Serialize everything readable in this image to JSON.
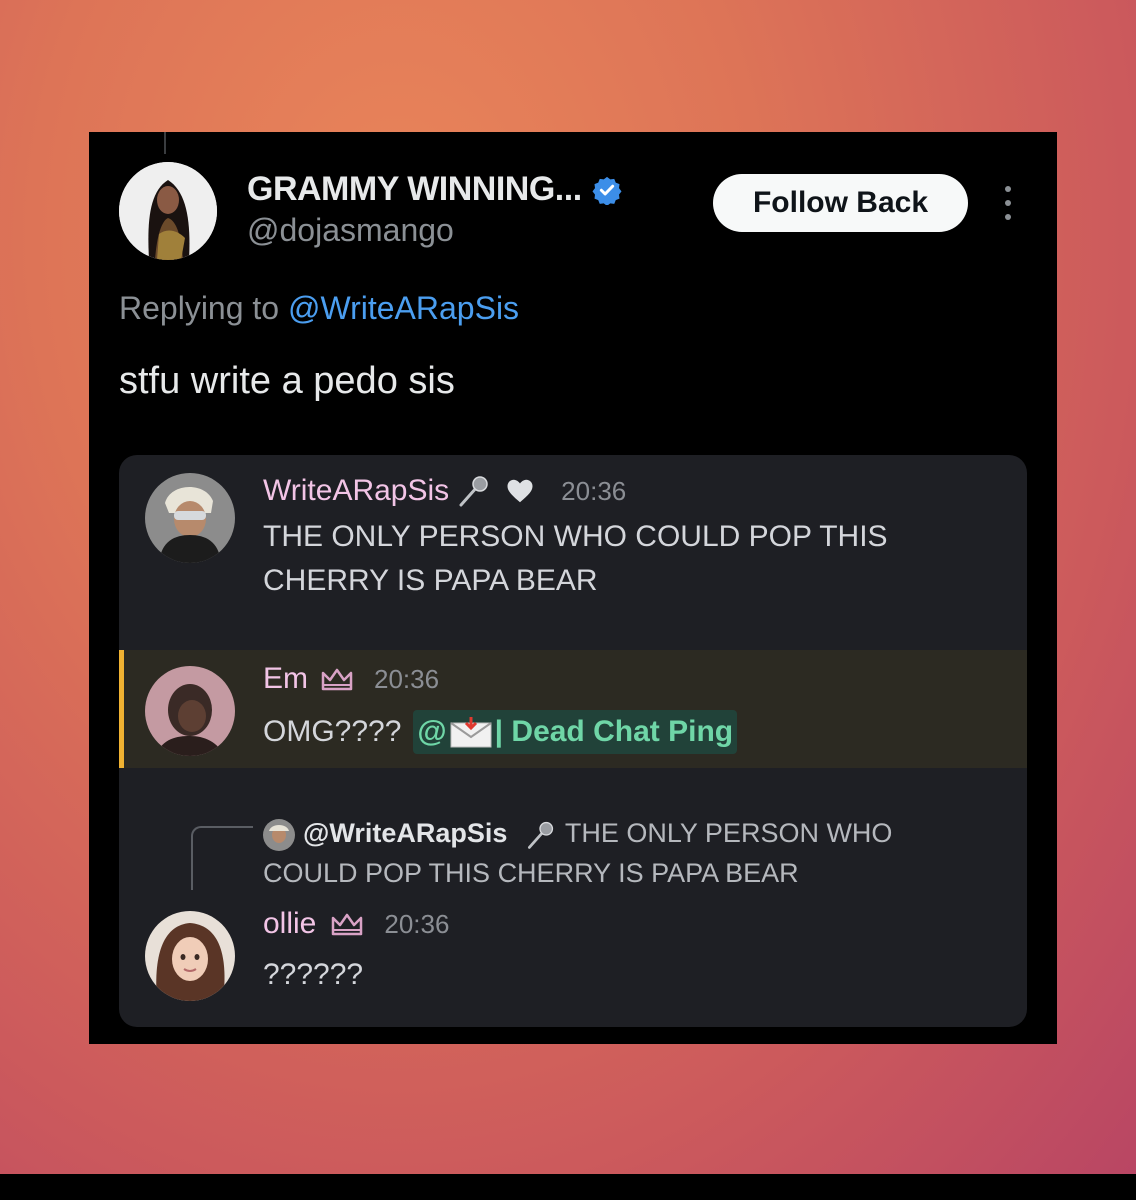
{
  "tweet": {
    "display_name": "GRAMMY WINNING...",
    "handle": "@dojasmango",
    "follow_label": "Follow Back",
    "replying_prefix": "Replying to",
    "replying_to": "@WriteARapSis",
    "text": "stfu write a pedo sis"
  },
  "discord": {
    "messages": [
      {
        "user": "WriteARapSis",
        "time": "20:36",
        "text_line1": "THE ONLY PERSON WHO COULD POP THIS",
        "text_line2": "CHERRY IS PAPA BEAR"
      },
      {
        "user": "Em",
        "time": "20:36",
        "text": "OMG????",
        "mention_at": "@",
        "mention_label": "| Dead Chat Ping"
      },
      {
        "reply_user": "@WriteARapSis",
        "reply_text_line1": "THE ONLY PERSON WHO",
        "reply_text_line2": "COULD POP THIS CHERRY IS PAPA BEAR",
        "user": "ollie",
        "time": "20:36",
        "text": "??????"
      }
    ]
  },
  "colors": {
    "verified": "#3c8ee8",
    "link": "#4b9ef0",
    "discord_username": "#f2c4e6",
    "highlight_bar": "#f0b232",
    "mention_text": "#6fd6a7"
  }
}
